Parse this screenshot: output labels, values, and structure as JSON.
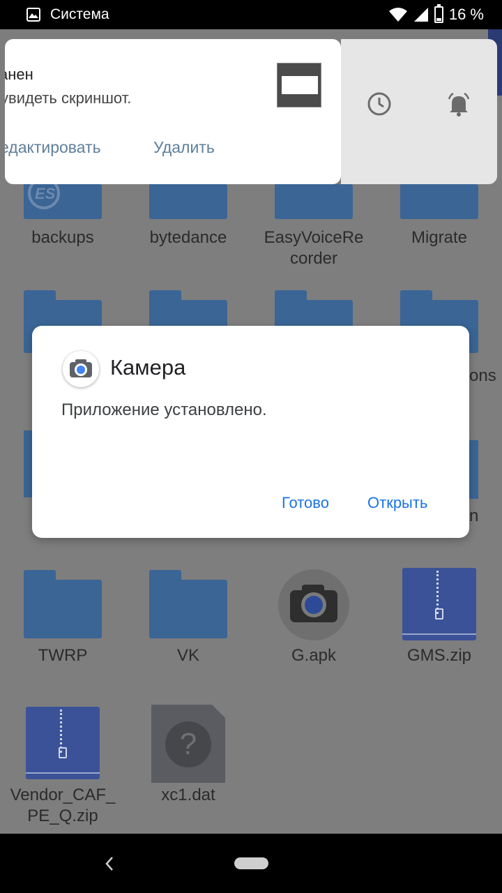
{
  "status_bar": {
    "app_name": "Система",
    "battery": "16 %"
  },
  "notification": {
    "title": "анен",
    "text": "увидеть скриншот.",
    "action_edit": "едактировать",
    "action_delete": "Удалить"
  },
  "files": [
    {
      "name": "backups",
      "icon": "es-folder-icon"
    },
    {
      "name": "bytedance",
      "icon": "folder-icon"
    },
    {
      "name": "EasyVoiceRe\ncorder",
      "icon": "folder-icon"
    },
    {
      "name": "Migrate",
      "icon": "folder-icon"
    },
    {
      "name": "TWRP",
      "icon": "folder-icon"
    },
    {
      "name": "VK",
      "icon": "folder-icon"
    },
    {
      "name": "G.apk",
      "icon": "camera-apk-icon"
    },
    {
      "name": "GMS.zip",
      "icon": "zip-icon"
    },
    {
      "name": "Vendor_CAF_\nPE_Q.zip",
      "icon": "zip-icon"
    },
    {
      "name": "xc1.dat",
      "icon": "unknown-file-icon"
    }
  ],
  "partial_labels": {
    "row2_right": "ons",
    "row3_right": "n"
  },
  "dialog": {
    "title": "Камера",
    "message": "Приложение установлено.",
    "done_label": "Готово",
    "open_label": "Открыть"
  },
  "colors": {
    "accent": "#1a73e8",
    "folder": "#3a6595",
    "zip": "#3b5298"
  }
}
